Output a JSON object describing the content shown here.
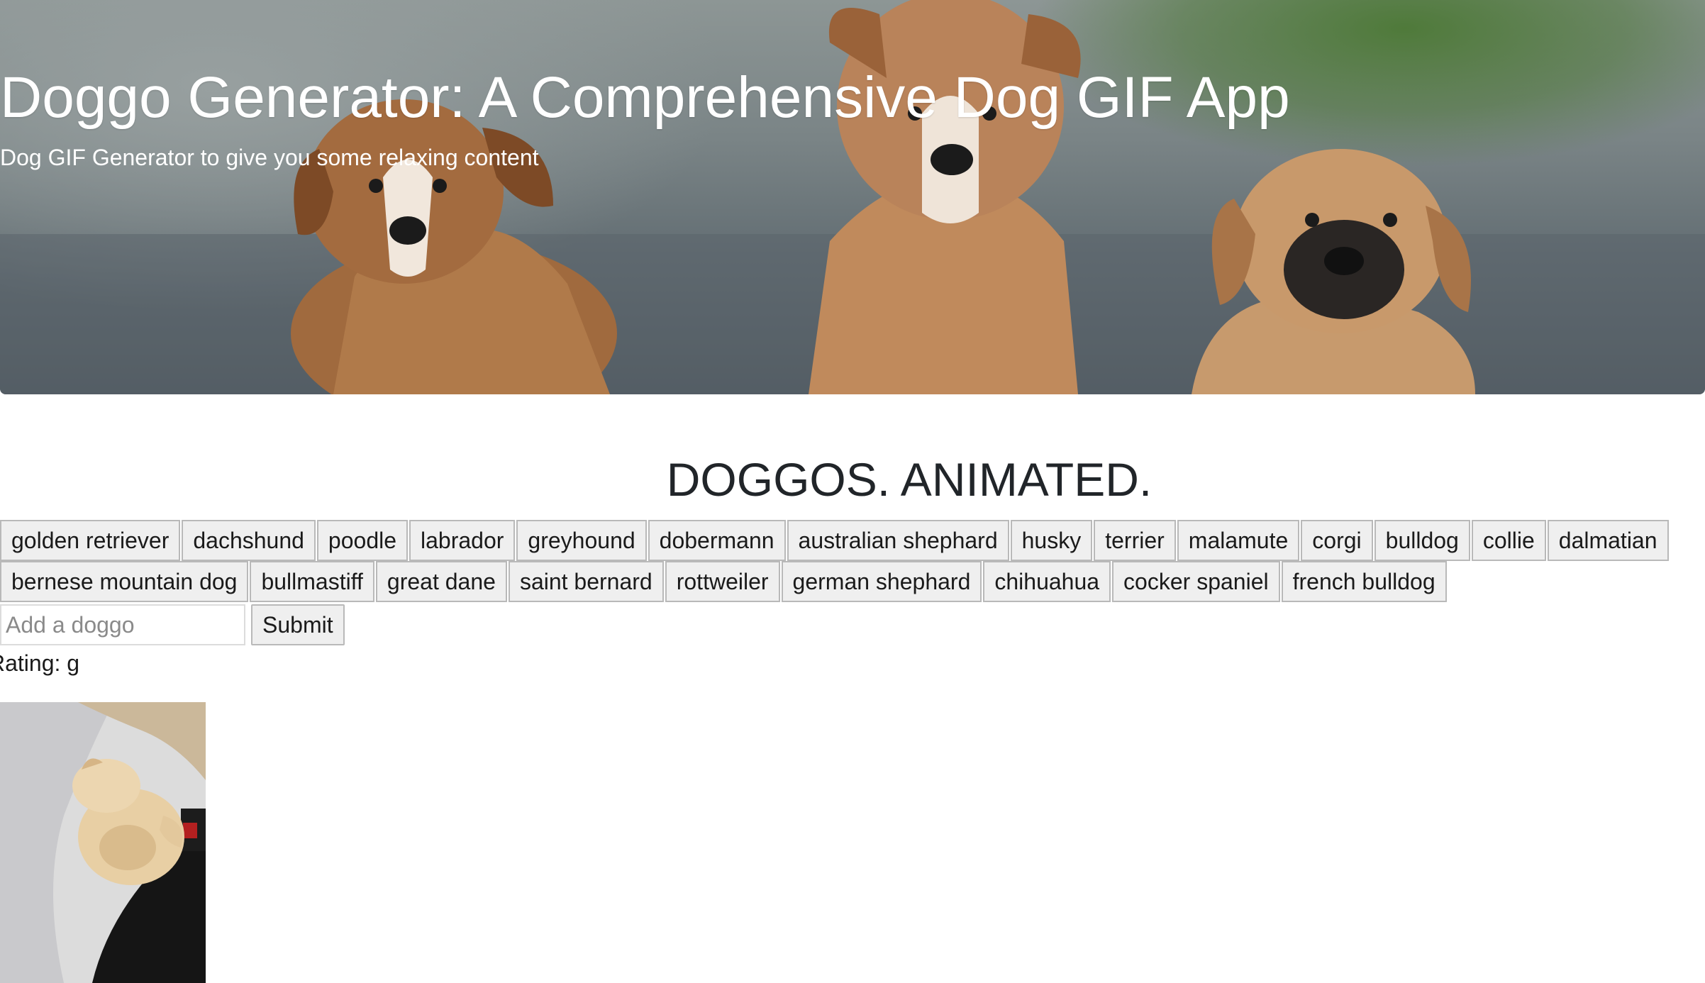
{
  "hero": {
    "title": "Doggo Generator: A Comprehensive Dog GIF App",
    "subtitle": "Dog GIF Generator to give you some relaxing content"
  },
  "section": {
    "heading": "DOGGOS. ANIMATED."
  },
  "breeds_row1": [
    "golden retriever",
    "dachshund",
    "poodle",
    "labrador",
    "greyhound",
    "dobermann",
    "australian shephard",
    "husky",
    "terrier",
    "malamute",
    "corgi",
    "bulldog",
    "collie",
    "dalmatian"
  ],
  "breeds_row2": [
    "bernese mountain dog",
    "bullmastiff",
    "great dane",
    "saint bernard",
    "rottweiler",
    "german shephard",
    "chihuahua",
    "cocker spaniel",
    "french bulldog"
  ],
  "form": {
    "placeholder": "Add a doggo",
    "submit_label": "Submit"
  },
  "gif": {
    "rating_text": "Rating: g"
  }
}
